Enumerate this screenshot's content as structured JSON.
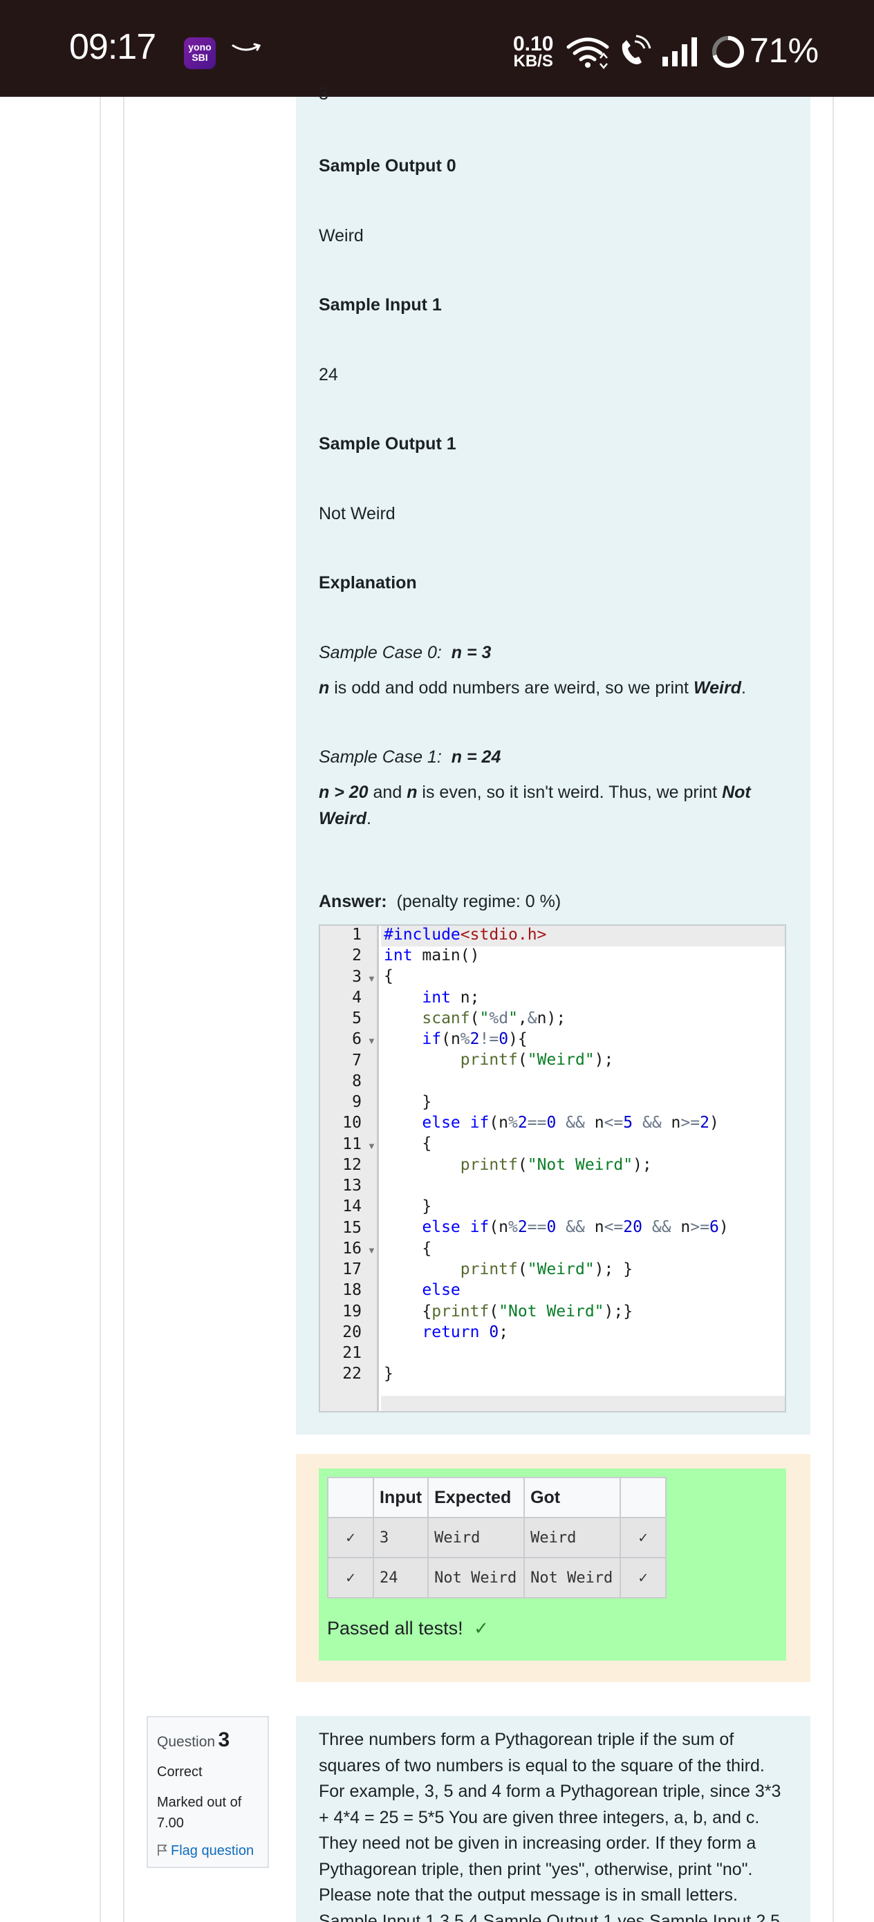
{
  "status_bar": {
    "time": "09:17",
    "app_icon_text": "yono SBI",
    "net_speed_value": "0.10",
    "net_speed_unit": "KB/S",
    "battery": "71%",
    "battery_level_percent": 71
  },
  "question_text": {
    "partial_top": "3",
    "sample_output_0_heading": "Sample Output 0",
    "sample_output_0": "Weird",
    "sample_input_1_heading": "Sample Input 1",
    "sample_input_1": "24",
    "sample_output_1_heading": "Sample Output 1",
    "sample_output_1": "Not Weird",
    "explanation_heading": "Explanation",
    "case0_label": "Sample Case 0:",
    "case0_value": "n = 3",
    "case0_n": "n",
    "case0_text": " is odd and odd numbers are weird, so we print ",
    "case0_result": "Weird",
    "case1_label": "Sample Case 1:",
    "case1_value": "n = 24",
    "case1_a": "n > 20",
    "case1_and": " and ",
    "case1_n": "n",
    "case1_text": " is even, so it isn't weird. Thus, we print ",
    "case1_result": "Not Weird",
    "period": "."
  },
  "answer": {
    "label": "Answer:",
    "penalty": "(penalty regime: 0 %)"
  },
  "editor": {
    "line_numbers": [
      "1",
      "2",
      "3",
      "4",
      "5",
      "6",
      "7",
      "8",
      "9",
      "10",
      "11",
      "12",
      "13",
      "14",
      "15",
      "16",
      "17",
      "18",
      "19",
      "20",
      "21",
      "22"
    ],
    "fold_lines": [
      3,
      6,
      11,
      16
    ]
  },
  "results": {
    "headers": [
      "",
      "Input",
      "Expected",
      "Got",
      ""
    ],
    "rows": [
      {
        "status": "✓",
        "input": "3",
        "expected": "Weird",
        "got": "Weird",
        "status2": "✓"
      },
      {
        "status": "✓",
        "input": "24",
        "expected": "Not Weird",
        "got": "Not Weird",
        "status2": "✓"
      }
    ],
    "passed_text": "Passed all tests!",
    "passed_icon": "✓"
  },
  "question3": {
    "label": "Question",
    "number": "3",
    "state": "Correct",
    "marks": "Marked out of 7.00",
    "flag": "Flag question",
    "text": "Three numbers form a Pythagorean triple if the sum of squares of two numbers is equal to the square of the third. For example, 3, 5 and 4 form a Pythagorean triple, since 3*3 + 4*4 = 25 = 5*5 You are given three integers, a, b, and c. They need not be given in increasing order. If they form a Pythagorean triple, then print \"yes\", otherwise, print \"no\". Please note that the output message is in small letters. Sample Input 1 3 5 4 Sample Output 1 yes Sample Input 2 5"
  },
  "colors": {
    "status_bar_bg": "#251616",
    "question_bg": "#e7f3f5",
    "result_outer_bg": "#fcefdc",
    "result_green": "#aaffaa",
    "flag_link": "#0f6cbf"
  }
}
